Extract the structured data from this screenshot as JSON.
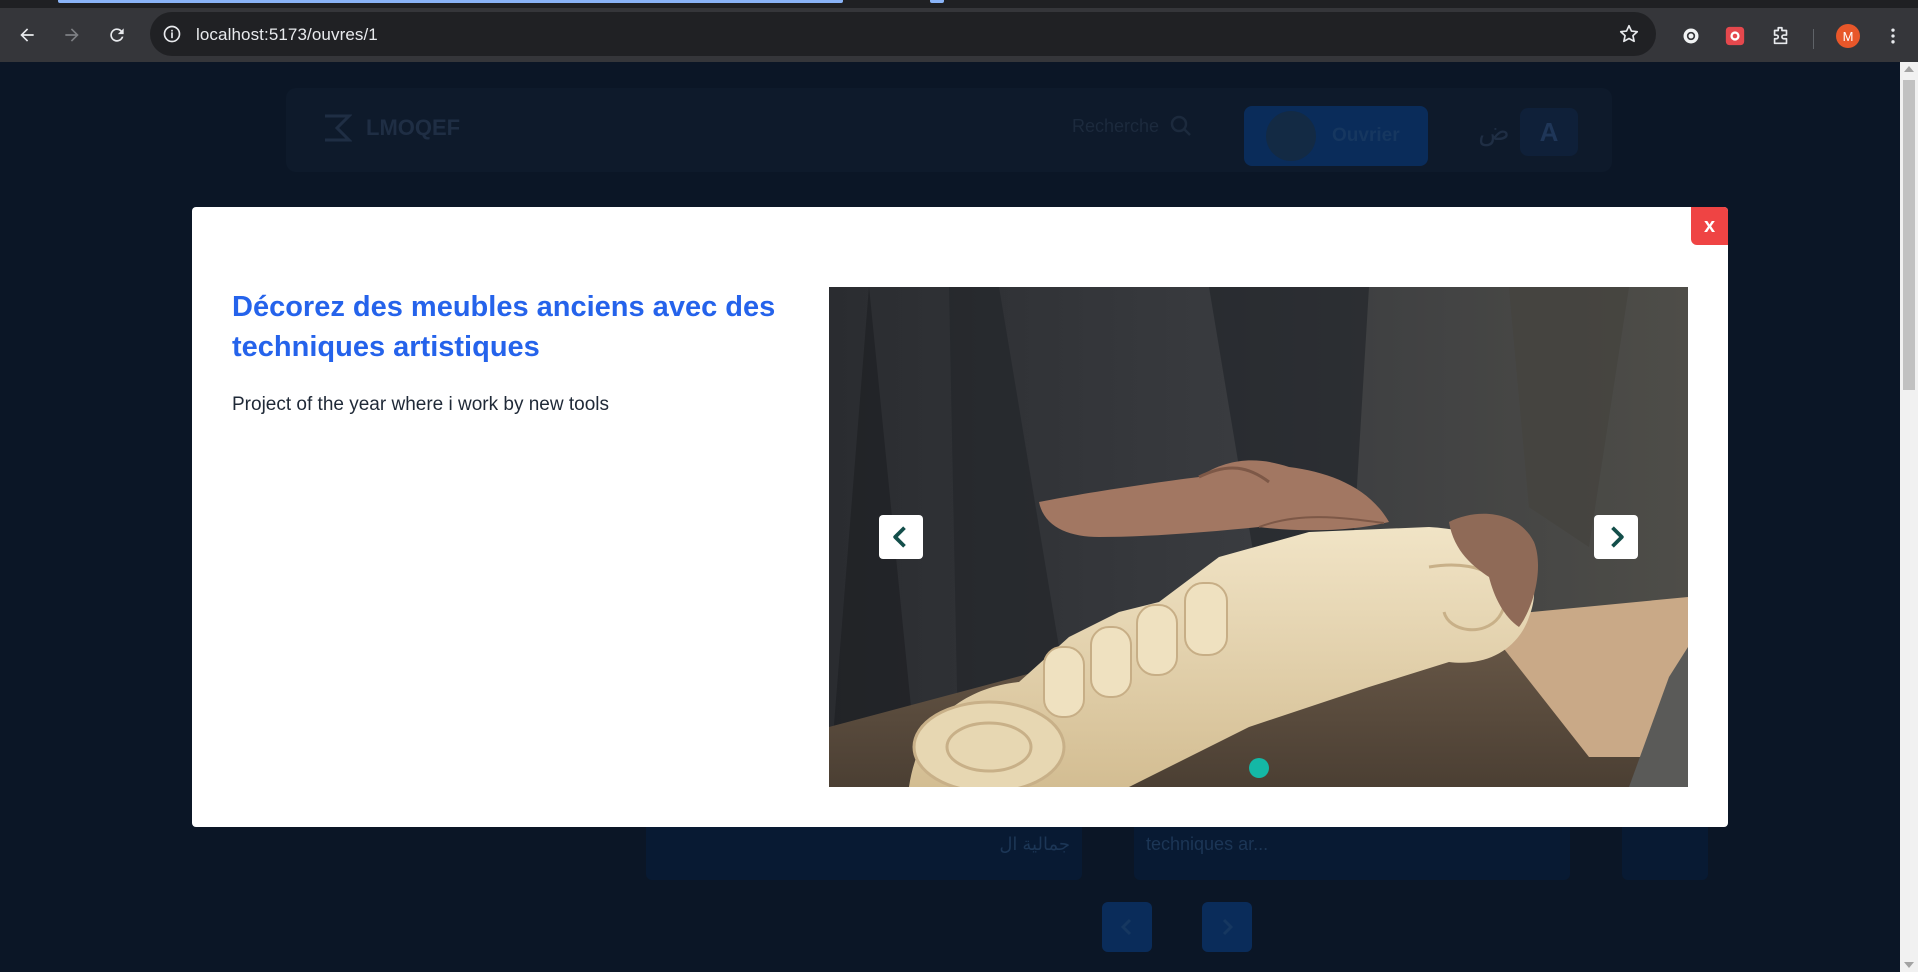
{
  "browser": {
    "url": "localhost:5173/ouvres/1",
    "avatar_letter": "M"
  },
  "navbar": {
    "brand": "LMOQEF",
    "search_placeholder": "Recherche",
    "user_button": "Ouvrier",
    "lang_arabic": "ض",
    "lang_latin": "A"
  },
  "cards": {
    "card1_text": "جمالية ال",
    "card2_text": "techniques ar..."
  },
  "modal": {
    "close_label": "x",
    "title": "Décorez des meubles anciens avec des techniques artistiques",
    "description": "Project of the year where i work by new tools",
    "carousel": {
      "image_alt": "carved wooden furniture piece being worked by hands",
      "active_slide": 1,
      "total_slides": 1
    }
  },
  "colors": {
    "accent_title": "#2563eb",
    "close": "#ef4444",
    "dot": "#14b8a6"
  }
}
